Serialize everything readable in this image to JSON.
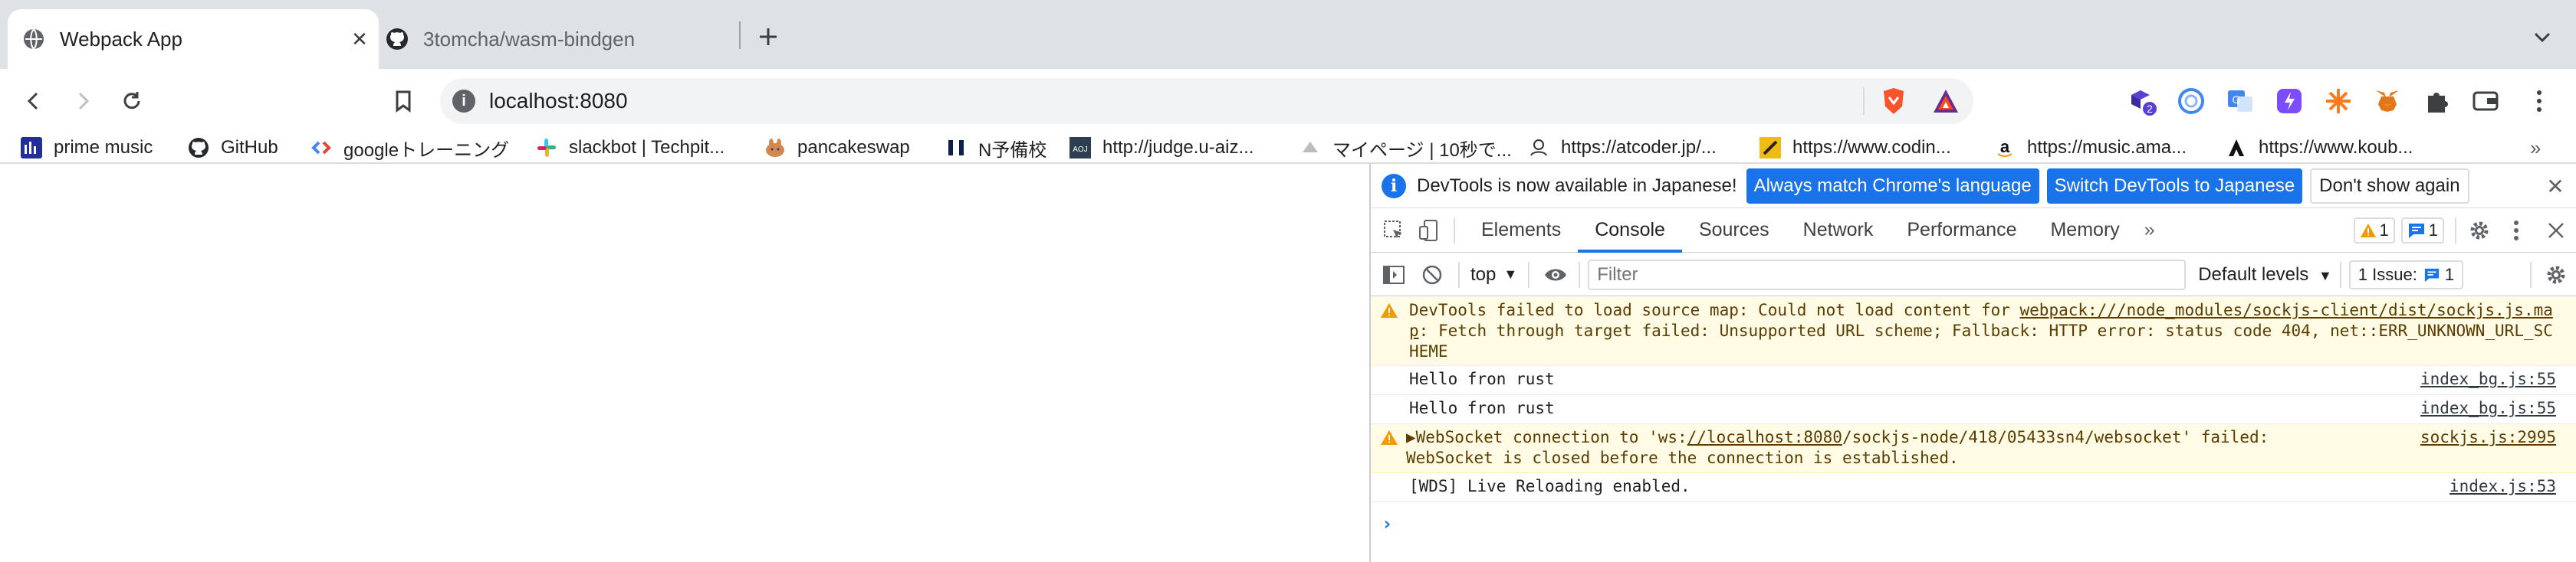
{
  "browser": {
    "tabs": [
      {
        "title": "Webpack App",
        "active": true,
        "favicon": "globe-icon"
      },
      {
        "title": "3tomcha/wasm-bindgen",
        "active": false,
        "favicon": "github-icon"
      }
    ],
    "omnibox": {
      "url": "localhost:8080"
    },
    "bookmarks": [
      {
        "label": "prime music",
        "icon": "prime-music-icon"
      },
      {
        "label": "GitHub",
        "icon": "github-icon"
      },
      {
        "label": "googleトレーニング",
        "icon": "google-code-icon"
      },
      {
        "label": "slackbot | Techpit...",
        "icon": "slack-icon"
      },
      {
        "label": "pancakeswap",
        "icon": "pancake-icon"
      },
      {
        "label": "N予備校",
        "icon": "n-yobiko-icon"
      },
      {
        "label": "http://judge.u-aiz...",
        "icon": "aoj-icon"
      },
      {
        "label": "マイページ | 10秒で...",
        "icon": "page-icon"
      },
      {
        "label": "https://atcoder.jp/...",
        "icon": "atcoder-icon"
      },
      {
        "label": "https://www.codin...",
        "icon": "codingame-icon"
      },
      {
        "label": "https://music.ama...",
        "icon": "amazon-icon"
      },
      {
        "label": "https://www.koub...",
        "icon": "kobe-icon"
      }
    ],
    "bookmarks_more": "»"
  },
  "devtools": {
    "infobar": {
      "message": "DevTools is now available in Japanese!",
      "btn_match": "Always match Chrome's language",
      "btn_switch": "Switch DevTools to Japanese",
      "btn_dismiss": "Don't show again"
    },
    "tabs": [
      "Elements",
      "Console",
      "Sources",
      "Network",
      "Performance",
      "Memory"
    ],
    "more_tabs": "»",
    "warning_count": "1",
    "message_count": "1",
    "console_toolbar": {
      "context": "top",
      "filter_placeholder": "Filter",
      "levels": "Default levels",
      "issues_label": "1 Issue:",
      "issues_count": "1"
    },
    "messages": [
      {
        "level": "warning",
        "text_pre": "DevTools failed to load source map: Could not load content for ",
        "link": "webpack:///node_modules/sockjs-client/dist/sockjs.js.map",
        "text_post": ": Fetch through target failed: Unsupported URL scheme; Fallback: HTTP error: status code 404, net::ERR_UNKNOWN_URL_SCHEME",
        "source": ""
      },
      {
        "level": "log",
        "text": "Hello fron rust",
        "source": "index_bg.js:55"
      },
      {
        "level": "log",
        "text": "Hello fron rust",
        "source": "index_bg.js:55"
      },
      {
        "level": "warning",
        "text_pre": "▶WebSocket connection to 'ws:",
        "link": "//localhost:8080",
        "text_post": "/sockjs-node/418/05433sn4/websocket' failed:\nWebSocket is closed before the connection is established.",
        "source": "sockjs.js:2995"
      },
      {
        "level": "log",
        "text": "[WDS] Live Reloading enabled.",
        "source": "index.js:53"
      }
    ],
    "prompt": "›"
  }
}
